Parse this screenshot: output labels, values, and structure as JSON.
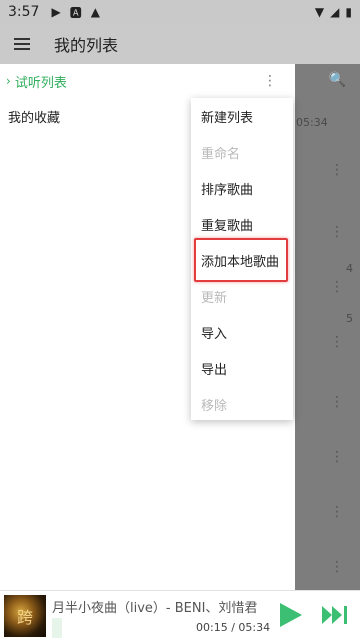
{
  "status_bar": {
    "time": "3:57",
    "icons": [
      "play-icon",
      "a-icon",
      "warning-icon"
    ],
    "right_icons": [
      "wifi-icon",
      "signal-icon",
      "battery-icon"
    ]
  },
  "app_bar": {
    "menu_icon": "menu-icon",
    "title": "我的列表"
  },
  "list_panel": {
    "trial_list_label": "试听列表",
    "favorites_label": "我的收藏"
  },
  "background_list": {
    "duration_a": "05:34",
    "duration_b": "4",
    "duration_c": "5"
  },
  "popup_menu": {
    "items": [
      {
        "label": "新建列表",
        "enabled": true
      },
      {
        "label": "重命名",
        "enabled": false
      },
      {
        "label": "排序歌曲",
        "enabled": true
      },
      {
        "label": "重复歌曲",
        "enabled": true
      },
      {
        "label": "添加本地歌曲",
        "enabled": true,
        "highlighted": true
      },
      {
        "label": "更新",
        "enabled": false
      },
      {
        "label": "导入",
        "enabled": true
      },
      {
        "label": "导出",
        "enabled": true
      },
      {
        "label": "移除",
        "enabled": false
      }
    ]
  },
  "player": {
    "song_title": "月半小夜曲（live）- BENI、刘惜君",
    "cover_art_text": "跨",
    "time": "00:15 / 05:34",
    "progress_fraction": 0.045
  },
  "colors": {
    "accent": "#3cbf73",
    "highlight_border": "#e23c3c"
  }
}
